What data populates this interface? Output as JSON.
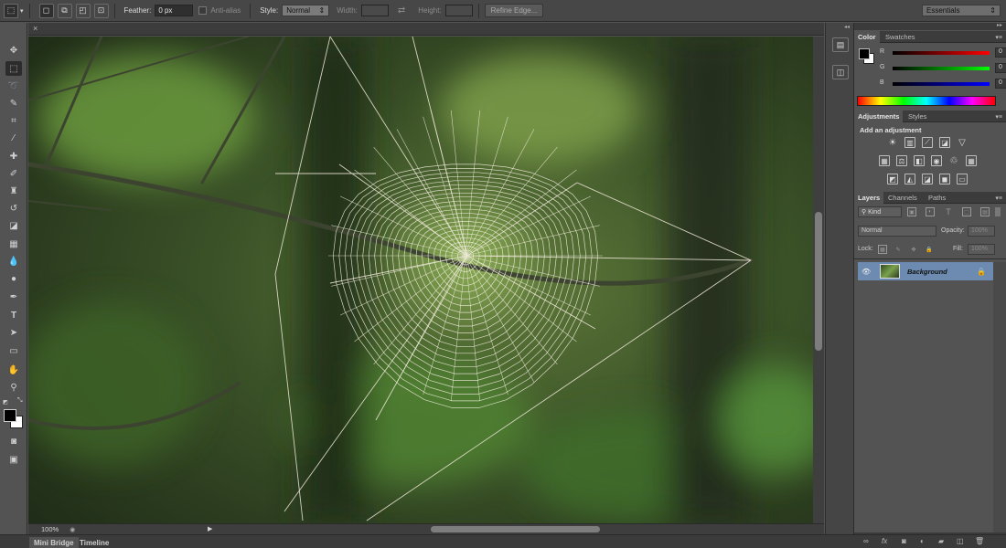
{
  "options_bar": {
    "feather_label": "Feather:",
    "feather_value": "0 px",
    "anti_alias_label": "Anti-alias",
    "style_label": "Style:",
    "style_value": "Normal",
    "width_label": "Width:",
    "height_label": "Height:",
    "refine_edge_label": "Refine Edge...",
    "workspace_value": "Essentials"
  },
  "status": {
    "zoom": "100%"
  },
  "bottom_tabs": [
    "Mini Bridge",
    "Timeline"
  ],
  "color_panel": {
    "tabs": [
      "Color",
      "Swatches"
    ],
    "r_label": "R",
    "g_label": "G",
    "b_label": "B",
    "r_value": "0",
    "g_value": "0",
    "b_value": "0"
  },
  "adjustments_panel": {
    "tabs": [
      "Adjustments",
      "Styles"
    ],
    "heading": "Add an adjustment"
  },
  "layers_panel": {
    "tabs": [
      "Layers",
      "Channels",
      "Paths"
    ],
    "filter_kind": "Kind",
    "blend_mode": "Normal",
    "opacity_label": "Opacity:",
    "opacity_value": "100%",
    "lock_label": "Lock:",
    "fill_label": "Fill:",
    "fill_value": "100%",
    "layer_name": "Background"
  },
  "colors": {
    "ui_dark": "#3c3c3c",
    "ui_panel": "#535353",
    "layer_selected": "#6d8bb0",
    "foreground": "#000000",
    "background": "#ffffff"
  }
}
